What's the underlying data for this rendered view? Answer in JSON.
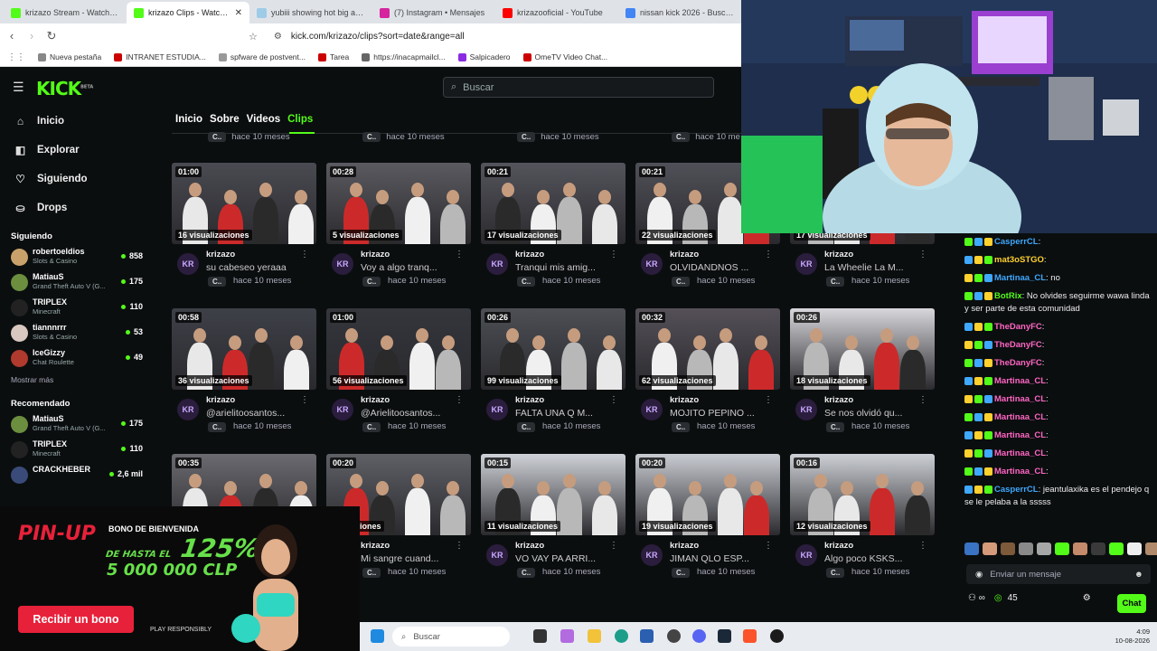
{
  "browser": {
    "tabs": [
      {
        "title": "krizazo Stream - Watch Live o",
        "color": "#53fc18",
        "active": false
      },
      {
        "title": "krizazo Clips - Watch Li",
        "color": "#53fc18",
        "active": true
      },
      {
        "title": "yubiii showing hot big ass ho",
        "color": "#9ecbe8",
        "active": false
      },
      {
        "title": "(7) Instagram • Mensajes",
        "color": "#d6249f",
        "active": false
      },
      {
        "title": "krizazooficial - YouTube",
        "color": "#ff0000",
        "active": false
      },
      {
        "title": "nissan kick 2026 - Buscar co",
        "color": "#4285f4",
        "active": false
      }
    ],
    "url": "kick.com/krizazo/clips?sort=date&range=all",
    "bookmarks": [
      "Nueva pestaña",
      "INTRANET ESTUDIA...",
      "spfware de postvent...",
      "Tarea",
      "https://inacapmailcl...",
      "Salpicadero",
      "OmeTV Video Chat..."
    ]
  },
  "header": {
    "logo": "KICK",
    "logo_tag": "BETA",
    "search_placeholder": "Buscar"
  },
  "sidebar": {
    "nav": [
      {
        "label": "Inicio",
        "icon": "⌂",
        "name": "home-icon"
      },
      {
        "label": "Explorar",
        "icon": "◧",
        "name": "compass-icon"
      },
      {
        "label": "Siguiendo",
        "icon": "♡",
        "name": "heart-icon"
      },
      {
        "label": "Drops",
        "icon": "⛀",
        "name": "gift-icon"
      }
    ],
    "following_title": "Siguiendo",
    "following": [
      {
        "name": "robertoeldios",
        "category": "Slots & Casino",
        "viewers": "858",
        "color": "#c9a26b"
      },
      {
        "name": "MatiauS",
        "category": "Grand Theft Auto V (G...",
        "viewers": "175",
        "color": "#6c8f3f"
      },
      {
        "name": "TRIPLEX",
        "category": "Minecraft",
        "viewers": "110",
        "color": "#222222"
      },
      {
        "name": "tiannnrrr",
        "category": "Slots & Casino",
        "viewers": "53",
        "color": "#d9c8c0"
      },
      {
        "name": "IceGizzy",
        "category": "Chat Roulette",
        "viewers": "49",
        "color": "#b03a2e"
      }
    ],
    "show_more": "Mostrar más",
    "recommended_title": "Recomendado",
    "recommended": [
      {
        "name": "MatiauS",
        "category": "Grand Theft Auto V (G...",
        "viewers": "175",
        "color": "#6c8f3f"
      },
      {
        "name": "TRIPLEX",
        "category": "Minecraft",
        "viewers": "110",
        "color": "#222222"
      },
      {
        "name": "CRACKHEBER",
        "category": "",
        "viewers": "2,6 mil",
        "color": "#3a4b7a"
      }
    ]
  },
  "subnav": [
    "Inicio",
    "Sobre",
    "Videos",
    "Clips"
  ],
  "clips_top_row": [
    "hace 10 meses",
    "hace 10 meses",
    "hace 10 meses",
    "hace 10 me"
  ],
  "clips": [
    {
      "duration": "01:00",
      "views": "16 visualizaciones",
      "author": "krizazo",
      "title": "su cabeseo yeraaa",
      "cat": "C..",
      "ago": "hace 10 meses",
      "bg": "#4a4a52"
    },
    {
      "duration": "00:28",
      "views": "5 visualizaciones",
      "author": "krizazo",
      "title": "Voy a algo tranq...",
      "cat": "C..",
      "ago": "hace 10 meses",
      "bg": "#5a5a60"
    },
    {
      "duration": "00:21",
      "views": "17 visualizaciones",
      "author": "krizazo",
      "title": "Tranqui mis amig...",
      "cat": "C..",
      "ago": "hace 10 meses",
      "bg": "#54545c"
    },
    {
      "duration": "00:21",
      "views": "22 visualizaciones",
      "author": "krizazo",
      "title": "OLVIDANDNOS ...",
      "cat": "C..",
      "ago": "hace 10 meses",
      "bg": "#505058"
    },
    {
      "duration": "",
      "views": "17 visualizaciones",
      "author": "krizazo",
      "title": "La Wheelie La M...",
      "cat": "C..",
      "ago": "hace 10 meses",
      "bg": "#4c4c55"
    },
    {
      "duration": "00:58",
      "views": "36 visualizaciones",
      "author": "krizazo",
      "title": "@arielitoosantos...",
      "cat": "C..",
      "ago": "hace 10 meses",
      "bg": "#3e4048"
    },
    {
      "duration": "01:00",
      "views": "56 visualizaciones",
      "author": "krizazo",
      "title": "@Arielitoosantos...",
      "cat": "C..",
      "ago": "hace 10 meses",
      "bg": "#34363c"
    },
    {
      "duration": "00:26",
      "views": "99 visualizaciones",
      "author": "krizazo",
      "title": "FALTA UNA Q M...",
      "cat": "C..",
      "ago": "hace 10 meses",
      "bg": "#4d4f55"
    },
    {
      "duration": "00:32",
      "views": "62 visualizaciones",
      "author": "krizazo",
      "title": "MOJITO PEPINO ...",
      "cat": "C..",
      "ago": "hace 10 meses",
      "bg": "#555058"
    },
    {
      "duration": "00:26",
      "views": "18 visualizaciones",
      "author": "krizazo",
      "title": "Se nos olvidó qu...",
      "cat": "C..",
      "ago": "hace 10 meses",
      "bg": "#d8d8dc"
    },
    {
      "duration": "00:35",
      "views": "",
      "author": "",
      "title": "",
      "cat": "",
      "ago": "",
      "bg": "#6a6a70"
    },
    {
      "duration": "00:20",
      "views": "ualizaciones",
      "author": "krizazo",
      "title": "Mi sangre cuand...",
      "cat": "C..",
      "ago": "hace 10 meses",
      "bg": "#5e6066"
    },
    {
      "duration": "00:15",
      "views": "11 visualizaciones",
      "author": "krizazo",
      "title": "VO VAY PA ARRI...",
      "cat": "C..",
      "ago": "hace 10 meses",
      "bg": "#cfd2d8"
    },
    {
      "duration": "00:20",
      "views": "19 visualizaciones",
      "author": "krizazo",
      "title": "JIMAN QLO ESP...",
      "cat": "C..",
      "ago": "hace 10 meses",
      "bg": "#c9ccd2"
    },
    {
      "duration": "00:16",
      "views": "12 visualizaciones",
      "author": "krizazo",
      "title": "Algo poco KSKS...",
      "cat": "C..",
      "ago": "hace 10 meses",
      "bg": "#cdd0d5"
    }
  ],
  "chat": {
    "messages": [
      {
        "user": "CasperrCL",
        "color": "#3fa8ff",
        "text": ""
      },
      {
        "user": "mat3oSTGO",
        "color": "#ffd12e",
        "text": ""
      },
      {
        "user": "Martinaa_CL",
        "color": "#3fa8ff",
        "text": "no"
      },
      {
        "user": "BotRix",
        "color": "#53fc18",
        "text": "No olvides seguirme wawa linda y ser parte de esta comunidad"
      },
      {
        "user": "TheDanyFC",
        "color": "#ff66c4",
        "text": ""
      },
      {
        "user": "TheDanyFC",
        "color": "#ff66c4",
        "text": ""
      },
      {
        "user": "TheDanyFC",
        "color": "#ff66c4",
        "text": ""
      },
      {
        "user": "Martinaa_CL",
        "color": "#ff66c4",
        "text": ""
      },
      {
        "user": "Martinaa_CL",
        "color": "#ff66c4",
        "text": ""
      },
      {
        "user": "Martinaa_CL",
        "color": "#ff66c4",
        "text": ""
      },
      {
        "user": "Martinaa_CL",
        "color": "#ff66c4",
        "text": ""
      },
      {
        "user": "Martinaa_CL",
        "color": "#ff66c4",
        "text": ""
      },
      {
        "user": "Martinaa_CL",
        "color": "#ff66c4",
        "text": ""
      },
      {
        "user": "CasperrCL",
        "color": "#3fa8ff",
        "text": "jeantulaxika es el pendejo q se le pelaba a la sssss"
      }
    ],
    "input_placeholder": "Enviar un mensaje",
    "points": "45",
    "chat_button": "Chat"
  },
  "ad": {
    "brand": "PIN-UP",
    "bono": "BONO DE BIENVENIDA",
    "hasta": "DE HASTA EL",
    "percent": "125%",
    "amount": "5 000 000 CLP",
    "button": "Recibir un bono",
    "responsible": "PLAY RESPONSIBLY"
  },
  "taskbar": {
    "search": "Buscar",
    "time": "4:09",
    "date": "10-08-2026"
  }
}
